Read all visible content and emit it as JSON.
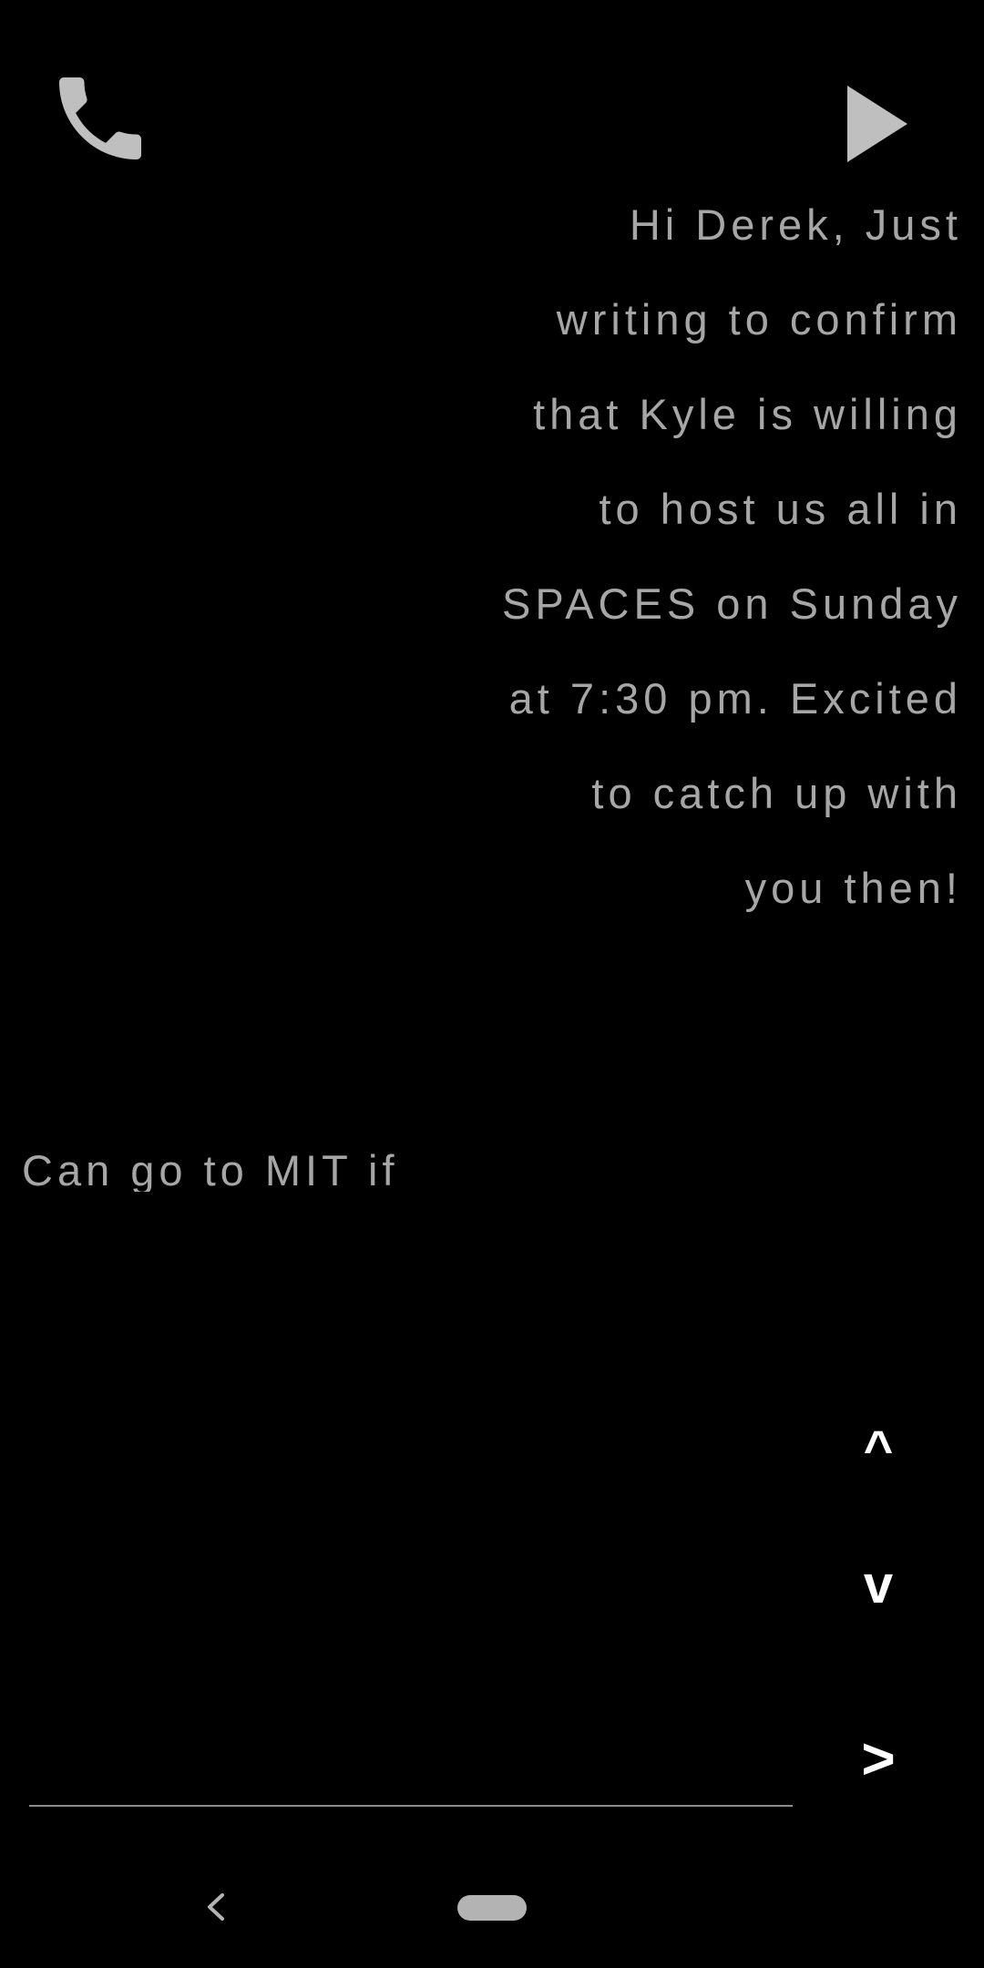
{
  "icons": {
    "call": "phone-icon",
    "play": "play-icon",
    "back": "back-icon",
    "home": "home-pill-icon"
  },
  "conversation": {
    "message_lines": [
      "Hi Derek, Just",
      "writing to confirm",
      "that Kyle is willing",
      "to host us all in",
      "SPACES on Sunday",
      "at 7:30 pm. Excited",
      "to catch up with",
      "you then!"
    ],
    "reply_text": "Can go to MIT if"
  },
  "controls": {
    "up_label": "^",
    "down_label": "v",
    "send_label": ">"
  },
  "colors": {
    "background": "#000000",
    "text": "#a6a6a6",
    "icon": "#bfbfbf",
    "control": "#ffffff",
    "underline": "#8c8c8c"
  }
}
